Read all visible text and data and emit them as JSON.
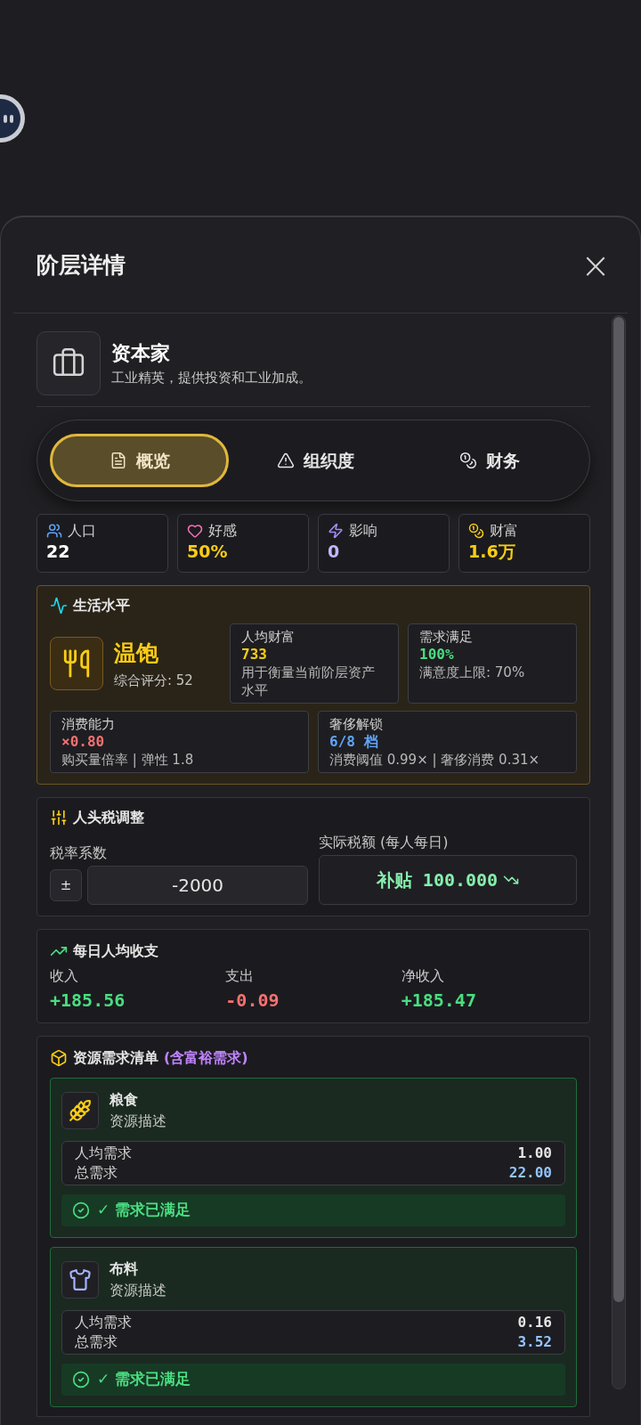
{
  "modal": {
    "title": "阶层详情",
    "close": "×"
  },
  "class_info": {
    "name": "资本家",
    "description": "工业精英，提供投资和工业加成。"
  },
  "tabs": [
    {
      "label": "概览",
      "selected": true
    },
    {
      "label": "组织度",
      "selected": false
    },
    {
      "label": "财务",
      "selected": false
    }
  ],
  "stats": [
    {
      "label": "人口",
      "value": "22"
    },
    {
      "label": "好感",
      "value": "50%"
    },
    {
      "label": "影响",
      "value": "0"
    },
    {
      "label": "财富",
      "value": "1.6万"
    }
  ],
  "living_standard": {
    "title": "生活水平",
    "level": "温饱",
    "score": "综合评分: 52",
    "cards": [
      {
        "label": "人均财富",
        "value": "733",
        "note": "用于衡量当前阶层资产水平"
      },
      {
        "label": "需求满足",
        "value": "100%",
        "note": "满意度上限: 70%"
      },
      {
        "label": "消费能力",
        "value": "×0.80",
        "note": "购买量倍率 | 弹性 1.8"
      },
      {
        "label": "奢侈解锁",
        "value": "6/8 档",
        "note": "消费阈值 0.99× | 奢侈消费 0.31×"
      }
    ]
  },
  "head_tax": {
    "title": "人头税调整",
    "rate_label": "税率系数",
    "sign_button": "±",
    "rate_value": "-2000",
    "actual_label": "实际税额 (每人每日)",
    "actual_value": "补贴 100.000"
  },
  "daily_income": {
    "title": "每日人均收支",
    "items": [
      {
        "label": "收入",
        "value": "+185.56",
        "kind": "positive"
      },
      {
        "label": "支出",
        "value": "-0.09",
        "kind": "negative"
      },
      {
        "label": "净收入",
        "value": "+185.47",
        "kind": "positive"
      }
    ]
  },
  "resources": {
    "title": "资源需求清单",
    "subtitle": "(含富裕需求)",
    "items": [
      {
        "name": "粮食",
        "description": "资源描述",
        "per_capita_label": "人均需求",
        "per_capita": "1.00",
        "total_label": "总需求",
        "total": "22.00",
        "status": "✓ 需求已满足",
        "satisfied": true
      },
      {
        "name": "布料",
        "description": "资源描述",
        "per_capita_label": "人均需求",
        "per_capita": "0.16",
        "total_label": "总需求",
        "total": "3.52",
        "status": "✓ 需求已满足",
        "satisfied": true
      }
    ]
  }
}
